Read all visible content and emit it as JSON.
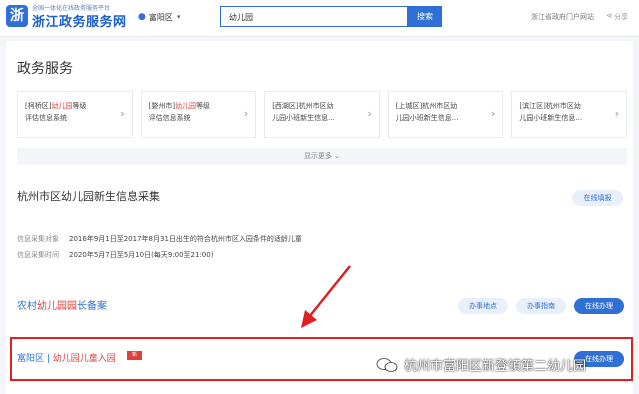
{
  "header": {
    "slogan": "全国一体化在线政务服务平台",
    "logo_text": "浙江政务服务网",
    "region": "富阳区",
    "search_value": "幼儿园",
    "search_button": "搜索",
    "portal_link": "浙江省政府门户网站",
    "share_label": "分享"
  },
  "services": {
    "title": "政务服务",
    "cards": [
      {
        "line1_a": "[柯桥区]",
        "line1_hl": "幼儿园",
        "line1_b": "等级",
        "line2": "评估信息系统"
      },
      {
        "line1_a": "[婺州市]",
        "line1_hl": "幼儿园",
        "line1_b": "等级",
        "line2": "评估信息系统"
      },
      {
        "line1_a": "[西湖区]杭州市区幼",
        "line1_hl": "",
        "line1_b": "",
        "line2": "儿园小班新生信息..."
      },
      {
        "line1_a": "[上城区]杭州市区幼",
        "line1_hl": "",
        "line1_b": "",
        "line2": "儿园小班新生信息..."
      },
      {
        "line1_a": "[滨江区]杭州市区幼",
        "line1_hl": "",
        "line1_b": "",
        "line2": "儿园小班新生信息..."
      }
    ],
    "more_label": "显示更多"
  },
  "item1": {
    "title": "杭州市区幼儿园新生信息采集",
    "online_fill": "在线填报",
    "collect_label": "信息采集对象",
    "collect_value": "2016年9月1日至2017年8月31日出生的符合杭州市区入园条件的适龄儿童",
    "time_label": "信息采集时间",
    "time_value": "2020年5月7日至5月10日(每天9:00至21:00)"
  },
  "item2": {
    "title_a": "农村",
    "title_hl": "幼儿园园",
    "title_b": "长备案",
    "btn_location": "办事地点",
    "btn_guide": "办事指南",
    "btn_online": "在线办理"
  },
  "item3": {
    "title_a": "富阳区 | ",
    "title_hl": "幼儿园儿童入园",
    "badge": "新",
    "btn_online": "在线办理"
  },
  "watermark": "杭州市富阳区新登镇第二幼儿园",
  "colors": {
    "accent": "#2f6fd6",
    "highlight": "#e0403a",
    "annotation": "#e02020"
  }
}
